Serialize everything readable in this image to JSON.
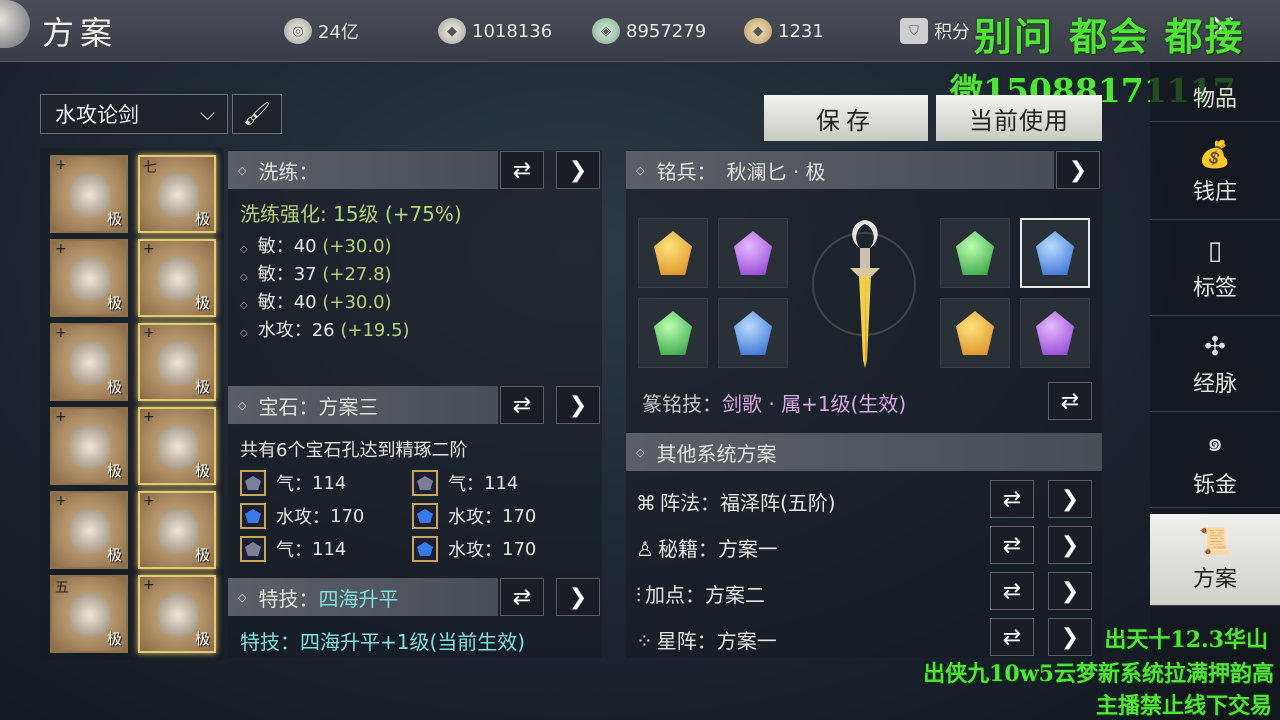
{
  "header": {
    "title": "方案",
    "resources": [
      {
        "icon": "coin-icon",
        "value": "24亿"
      },
      {
        "icon": "silver-ingot-icon",
        "value": "1018136"
      },
      {
        "icon": "jade-icon",
        "value": "8957279"
      },
      {
        "icon": "gold-ingot-icon",
        "value": "1231"
      }
    ],
    "points_label": "积分"
  },
  "watermark": {
    "line1": "别问 都会 都接",
    "line2": "微15088171117",
    "bottom1": "出天十12.3华山",
    "bottom2": "出侠九10w5云梦新系统拉满押韵高",
    "bottom3": "主播禁止线下交易"
  },
  "plan_dropdown": {
    "value": "水攻论剑"
  },
  "buttons": {
    "save": "保存",
    "use_current": "当前使用"
  },
  "equipment": [
    {
      "top": "+",
      "quality": "极"
    },
    {
      "top": "七",
      "quality": "极"
    },
    {
      "top": "+",
      "quality": "极"
    },
    {
      "top": "+",
      "quality": "极"
    },
    {
      "top": "+",
      "quality": "极"
    },
    {
      "top": "+",
      "quality": "极"
    },
    {
      "top": "+",
      "quality": "极"
    },
    {
      "top": "+",
      "quality": "极"
    },
    {
      "top": "+",
      "quality": "极"
    },
    {
      "top": "+",
      "quality": "极"
    },
    {
      "top": "五",
      "quality": "极"
    },
    {
      "top": "+",
      "quality": "极"
    }
  ],
  "refine": {
    "title": "洗练：",
    "level": "洗练强化: 15级 (+75%)",
    "stats": [
      {
        "name": "敏：",
        "val": "40",
        "bonus": "(+30.0)"
      },
      {
        "name": "敏：",
        "val": "37",
        "bonus": "(+27.8)"
      },
      {
        "name": "敏：",
        "val": "40",
        "bonus": "(+30.0)"
      },
      {
        "name": "水攻：",
        "val": "26",
        "bonus": "(+19.5)"
      }
    ]
  },
  "gems": {
    "title": "宝石：",
    "plan": "方案三",
    "desc": "共有6个宝石孔达到精琢二阶",
    "items": [
      {
        "name": "气：",
        "val": "114"
      },
      {
        "name": "气：",
        "val": "114"
      },
      {
        "name": "水攻：",
        "val": "170"
      },
      {
        "name": "水攻：",
        "val": "170"
      },
      {
        "name": "气：",
        "val": "114"
      },
      {
        "name": "水攻：",
        "val": "170"
      }
    ]
  },
  "skill": {
    "title": "特技：",
    "name": "四海升平",
    "desc": "特技：四海升平+1级(当前生效)"
  },
  "weapon": {
    "title": "铭兵：",
    "name": "秋澜匕 · 极",
    "engrave_label": "篆铭技：",
    "engrave_value": "剑歌 · 属+1级(生效)"
  },
  "other": {
    "title": "其他系统方案",
    "rows": [
      {
        "icon": "formation-icon",
        "label": "阵法：",
        "value": "福泽阵(五阶)"
      },
      {
        "icon": "meditation-icon",
        "label": "秘籍：",
        "value": "方案一"
      },
      {
        "icon": "sliders-icon",
        "label": "加点：",
        "value": "方案二"
      },
      {
        "icon": "constellation-icon",
        "label": "星阵：",
        "value": "方案一"
      }
    ]
  },
  "sidebar": [
    {
      "label": "物品",
      "icon": "bag-icon"
    },
    {
      "label": "钱庄",
      "icon": "money-bag-icon"
    },
    {
      "label": "标签",
      "icon": "tag-icon"
    },
    {
      "label": "经脉",
      "icon": "meridian-icon"
    },
    {
      "label": "铄金",
      "icon": "swirl-icon"
    },
    {
      "label": "方案",
      "icon": "scroll-icon"
    }
  ]
}
